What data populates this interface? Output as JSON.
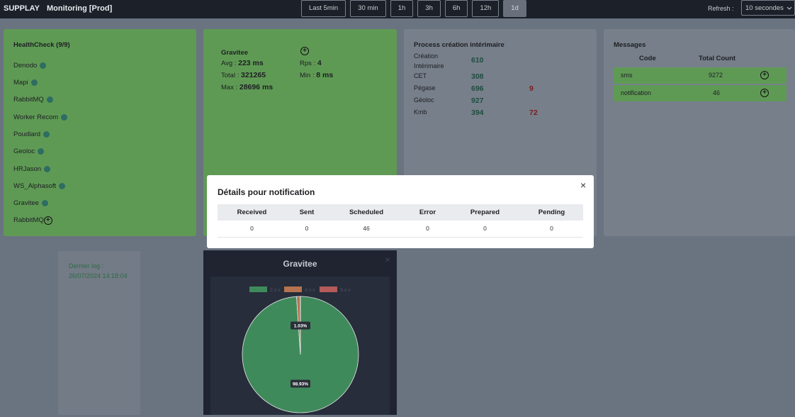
{
  "topbar": {
    "brand": "SUPPLAY",
    "env": "Monitoring [Prod]",
    "time_buttons": [
      "Last 5min",
      "30 min",
      "1h",
      "3h",
      "6h",
      "12h",
      "1d"
    ],
    "active_time": "1d",
    "refresh_label": "Refresh :",
    "refresh_value": "10 secondes"
  },
  "healthcheck": {
    "title": "HealthCheck (9/9)",
    "items": [
      "Denodo",
      "Mapi",
      "RabbitMQ",
      "Worker Recom",
      "Poudlard",
      "Geoloc",
      "HRJason",
      "WS_Alphasoft",
      "Gravitee"
    ],
    "extra_item": "RabbitMQ"
  },
  "gravitee_card": {
    "title": "Gravitee",
    "avg_label": "Avg :",
    "avg_value": "223 ms",
    "total_label": "Total :",
    "total_value": "321265",
    "max_label": "Max :",
    "max_value": "28696 ms",
    "rps_label": "Rps :",
    "rps_value": "4",
    "min_label": "Min :",
    "min_value": "8 ms"
  },
  "process": {
    "title": "Process création intérimaire",
    "rows": [
      {
        "label": "Création Intérimaire",
        "label_line1": "Création",
        "label_line2": "Intérimaire",
        "value": "610",
        "error": ""
      },
      {
        "label": "CET",
        "value": "308",
        "error": ""
      },
      {
        "label": "Pégase",
        "value": "696",
        "error": "9"
      },
      {
        "label": "Géoloc",
        "value": "927",
        "error": ""
      },
      {
        "label": "Kmb",
        "value": "394",
        "error": "72"
      }
    ]
  },
  "messages": {
    "title": "Messages",
    "col_code": "Code",
    "col_total": "Total Count",
    "rows": [
      {
        "code": "sms",
        "count": "9272"
      },
      {
        "code": "notification",
        "count": "46"
      }
    ]
  },
  "last_log": {
    "label": "Dernier log :",
    "value": "26/07/2024 14:18:04"
  },
  "gravitee_chart_panel": {
    "title": "Gravitee",
    "close": "×"
  },
  "chart_data": {
    "type": "pie",
    "title": "Gravitee",
    "legend": [
      "2.x.x",
      "4.x.x",
      "5.x.x"
    ],
    "slices": [
      {
        "name": "2.x.x",
        "value": 98.93,
        "label": "98.93%",
        "color": "#3f8a5b"
      },
      {
        "name": "4.x.x",
        "value": 1.03,
        "label": "1.03%",
        "color": "#b5734f"
      },
      {
        "name": "5.x.x",
        "value": 0.04,
        "label": "",
        "color": "#b55b5b"
      }
    ]
  },
  "modal": {
    "title": "Détails pour notification",
    "close": "×",
    "headers": [
      "Received",
      "Sent",
      "Scheduled",
      "Error",
      "Prepared",
      "Pending"
    ],
    "row": [
      "0",
      "0",
      "46",
      "0",
      "0",
      "0"
    ]
  },
  "colors": {
    "topbar": "#1b2029",
    "card_green": "#5f9a55",
    "status_dot": "#2e6d62",
    "error_red": "#7a1d1d"
  }
}
